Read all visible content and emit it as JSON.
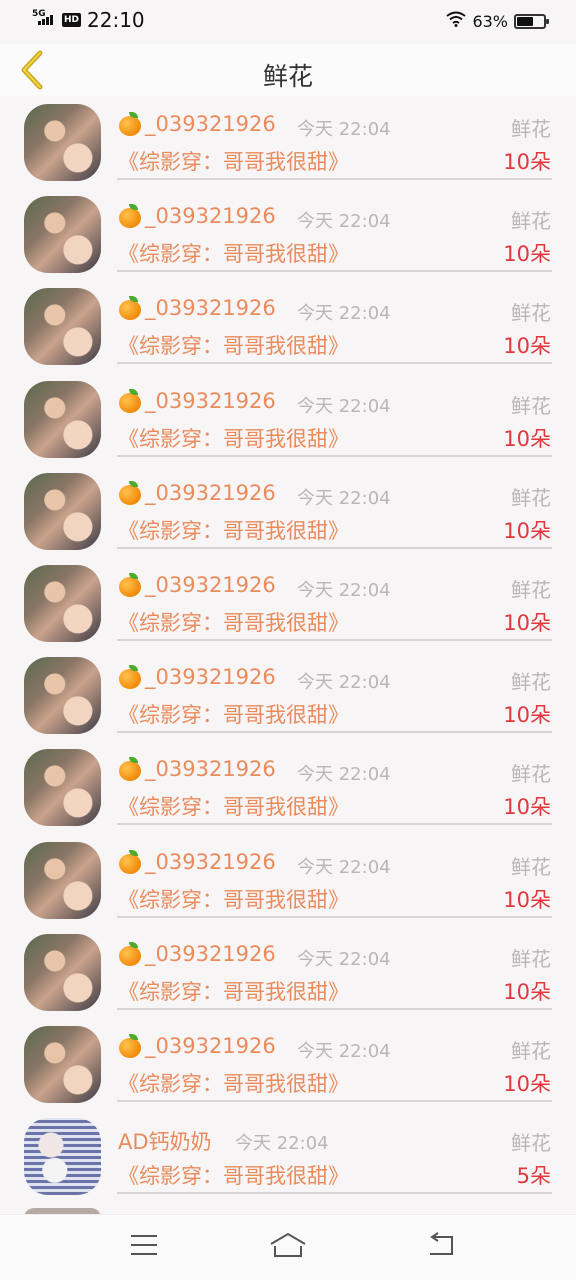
{
  "status_bar": {
    "network": "5G",
    "hd": "HD",
    "time": "22:10",
    "battery_percent": "63%",
    "battery_level": 0.63,
    "icons": [
      "signal-icon",
      "wifi-icon",
      "battery-icon"
    ]
  },
  "header": {
    "back_icon": "chevron-left-icon",
    "title": "鲜花"
  },
  "rows": [
    {
      "name": "_039321926",
      "has_orange": true,
      "time": "今天 22:04",
      "gift": "鲜花",
      "book": "《综影穿：哥哥我很甜》",
      "count": "10朵"
    },
    {
      "name": "_039321926",
      "has_orange": true,
      "time": "今天 22:04",
      "gift": "鲜花",
      "book": "《综影穿：哥哥我很甜》",
      "count": "10朵"
    },
    {
      "name": "_039321926",
      "has_orange": true,
      "time": "今天 22:04",
      "gift": "鲜花",
      "book": "《综影穿：哥哥我很甜》",
      "count": "10朵"
    },
    {
      "name": "_039321926",
      "has_orange": true,
      "time": "今天 22:04",
      "gift": "鲜花",
      "book": "《综影穿：哥哥我很甜》",
      "count": "10朵"
    },
    {
      "name": "_039321926",
      "has_orange": true,
      "time": "今天 22:04",
      "gift": "鲜花",
      "book": "《综影穿：哥哥我很甜》",
      "count": "10朵"
    },
    {
      "name": "_039321926",
      "has_orange": true,
      "time": "今天 22:04",
      "gift": "鲜花",
      "book": "《综影穿：哥哥我很甜》",
      "count": "10朵"
    },
    {
      "name": "_039321926",
      "has_orange": true,
      "time": "今天 22:04",
      "gift": "鲜花",
      "book": "《综影穿：哥哥我很甜》",
      "count": "10朵"
    },
    {
      "name": "_039321926",
      "has_orange": true,
      "time": "今天 22:04",
      "gift": "鲜花",
      "book": "《综影穿：哥哥我很甜》",
      "count": "10朵"
    },
    {
      "name": "_039321926",
      "has_orange": true,
      "time": "今天 22:04",
      "gift": "鲜花",
      "book": "《综影穿：哥哥我很甜》",
      "count": "10朵"
    },
    {
      "name": "_039321926",
      "has_orange": true,
      "time": "今天 22:04",
      "gift": "鲜花",
      "book": "《综影穿：哥哥我很甜》",
      "count": "10朵"
    },
    {
      "name": "_039321926",
      "has_orange": true,
      "time": "今天 22:04",
      "gift": "鲜花",
      "book": "《综影穿：哥哥我很甜》",
      "count": "10朵"
    },
    {
      "name": "AD钙奶奶",
      "has_orange": false,
      "time": "今天 22:04",
      "gift": "鲜花",
      "book": "《综影穿：哥哥我很甜》",
      "count": "5朵"
    }
  ],
  "nav_bar": {
    "icons": [
      "menu-icon",
      "home-icon",
      "back-icon"
    ]
  },
  "colors": {
    "accent_orange": "#e98b5c",
    "count_red": "#e0383d",
    "muted_gray": "#b9b6b7",
    "back_chevron": "#c9a820"
  }
}
